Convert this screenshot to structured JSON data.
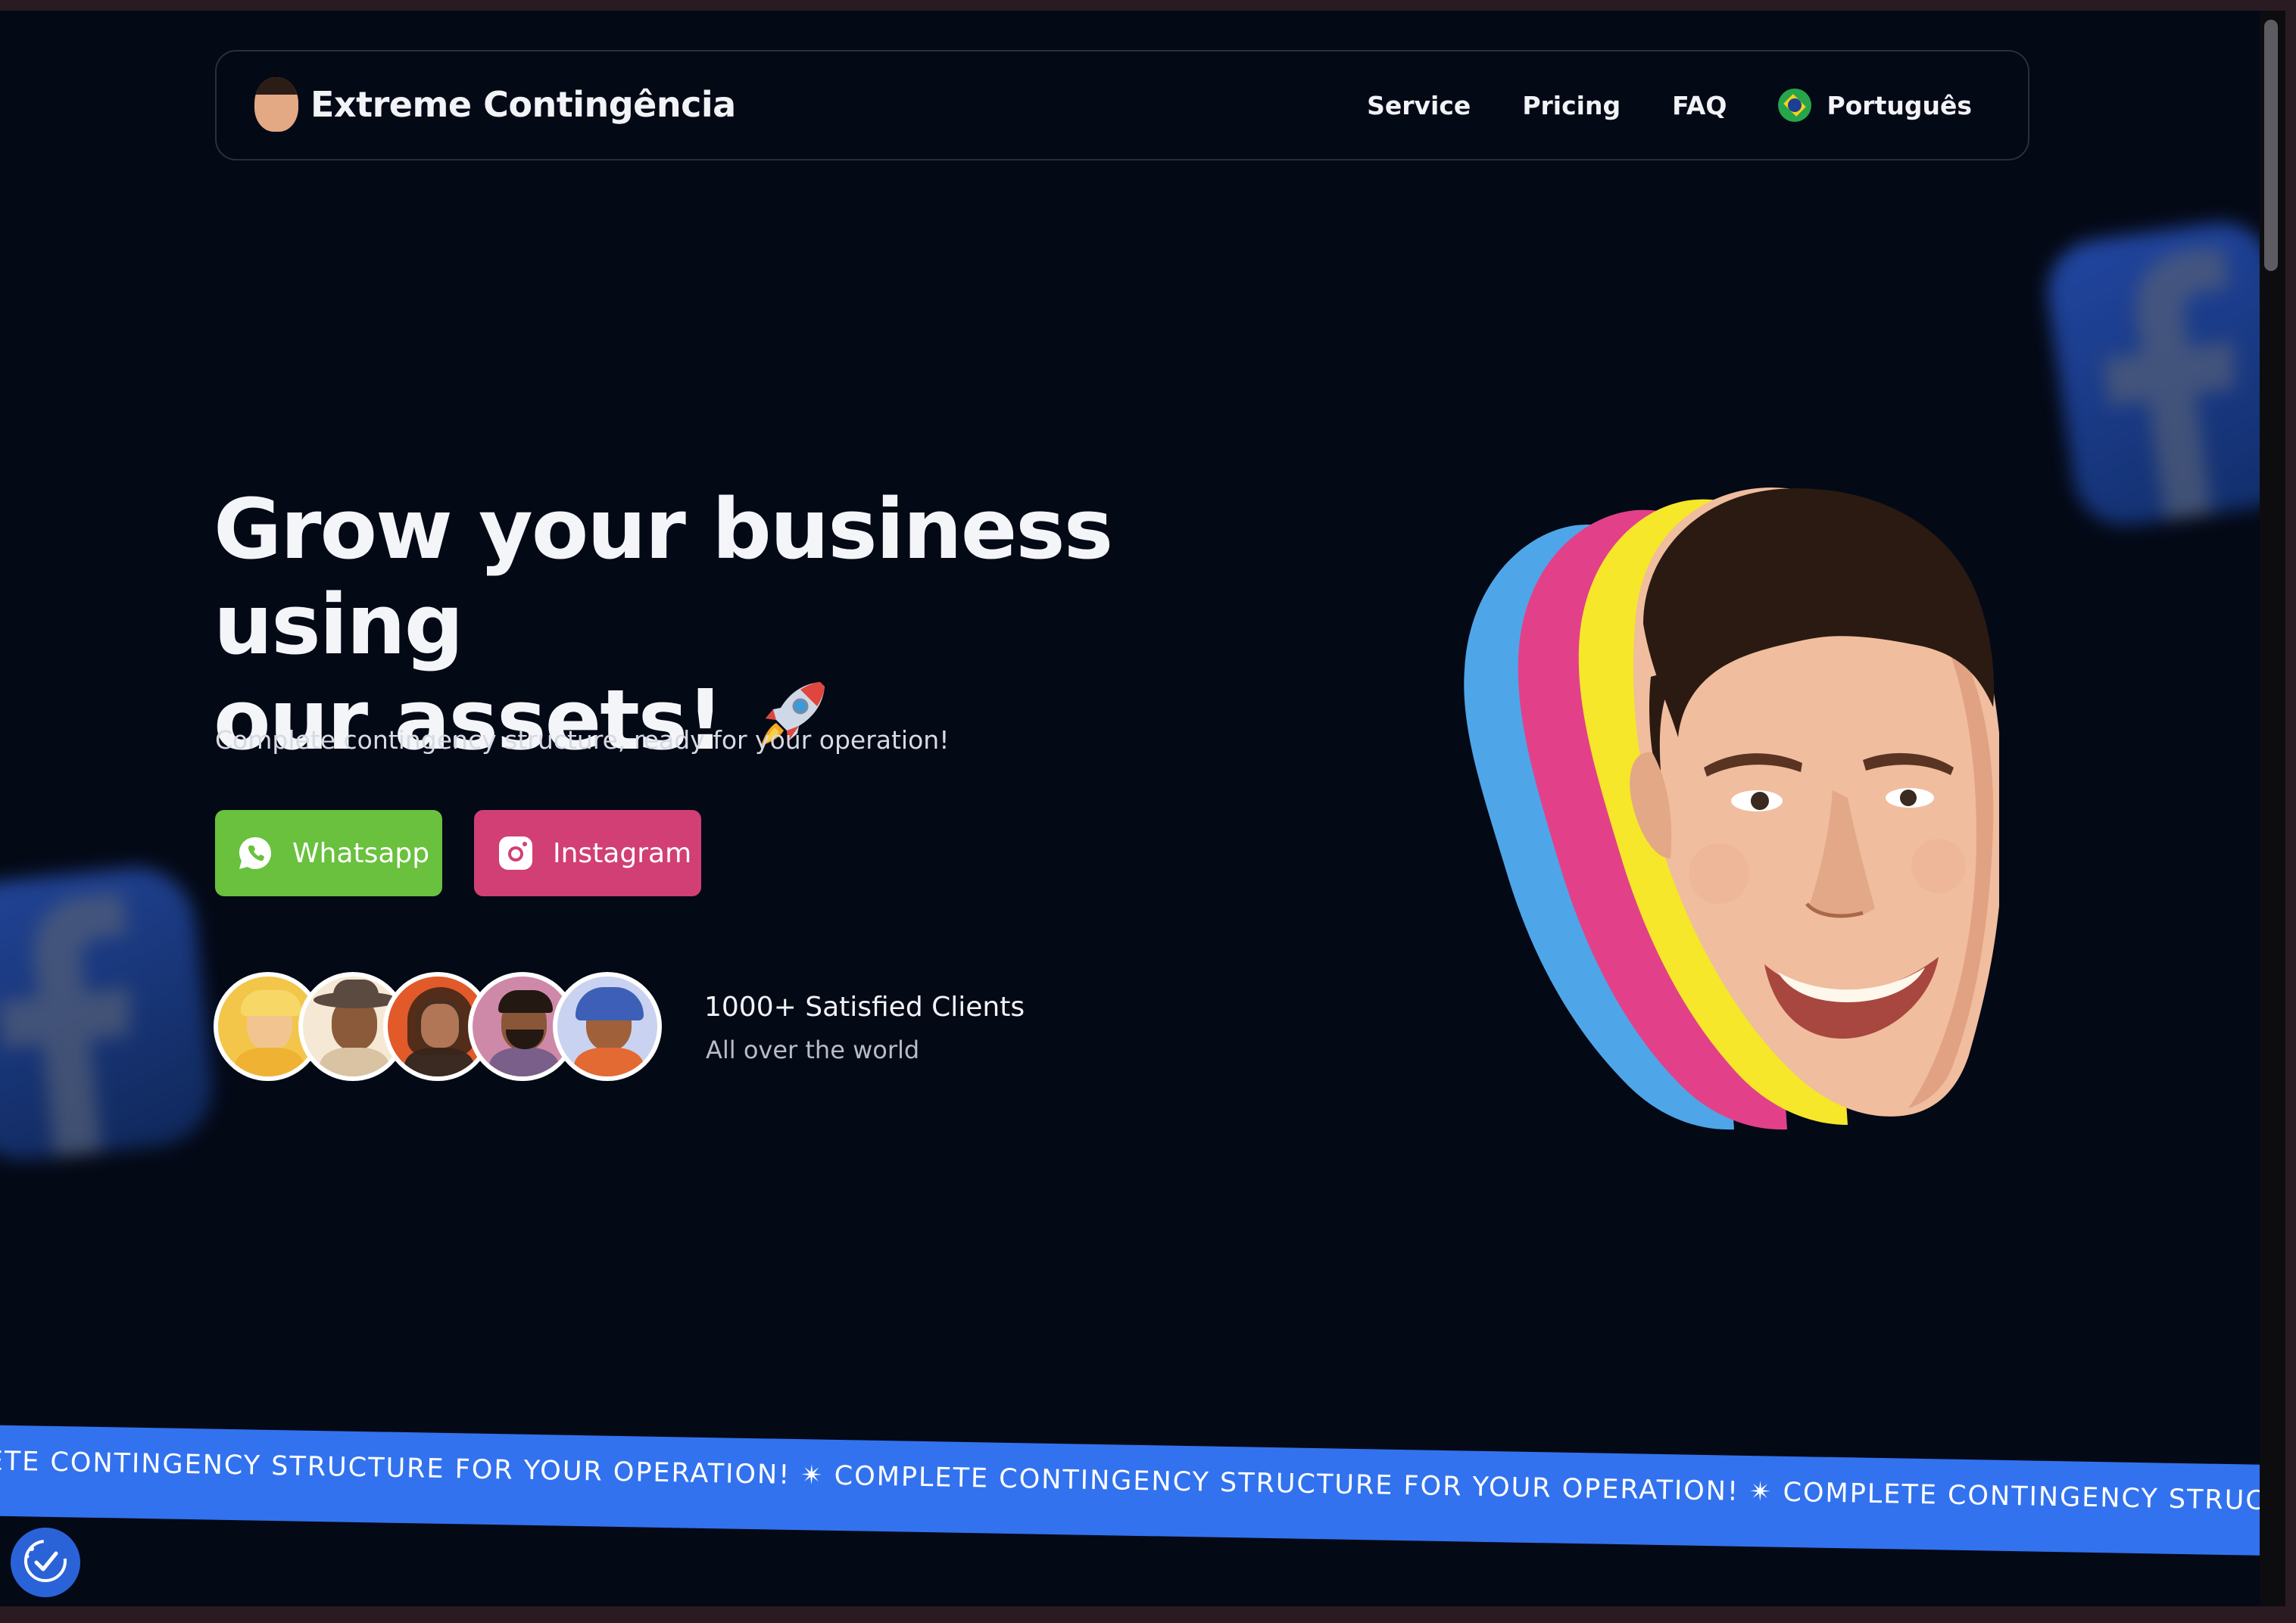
{
  "brand": {
    "name": "Extreme Contingência"
  },
  "nav": {
    "items": [
      {
        "label": "Service"
      },
      {
        "label": "Pricing"
      },
      {
        "label": "FAQ"
      }
    ],
    "language": "Português"
  },
  "hero": {
    "title_line1": "Grow your business using",
    "title_line2": "our assets!",
    "subtitle": "Complete contingency structure, ready for your operation!",
    "buttons": {
      "whatsapp": "Whatsapp",
      "instagram": "Instagram"
    },
    "clients": {
      "title": "1000+ Satisfied Clients",
      "subtitle": "All over the world"
    }
  },
  "ticker": {
    "text": "LETE CONTINGENCY STRUCTURE FOR YOUR OPERATION!  ✴  COMPLETE CONTINGENCY STRUCTURE FOR YOUR OPERATION!  ✴  COMPLETE CONTINGENCY STRUCTURE FOR YOUR OPERATION!"
  },
  "colors": {
    "background": "#040916",
    "whatsapp_green": "#69c13d",
    "instagram_pink": "#d13f74",
    "ticker_blue": "#3272ee",
    "face_layer_blue": "#4ea6e8",
    "face_layer_pink": "#e2418a",
    "face_layer_yellow": "#f6e72a"
  },
  "icons": {
    "whatsapp": "whatsapp-icon",
    "instagram": "instagram-icon",
    "flag": "brazil-flag-icon",
    "rocket": "rocket-emoji",
    "accessibility": "accessibility-icon"
  }
}
